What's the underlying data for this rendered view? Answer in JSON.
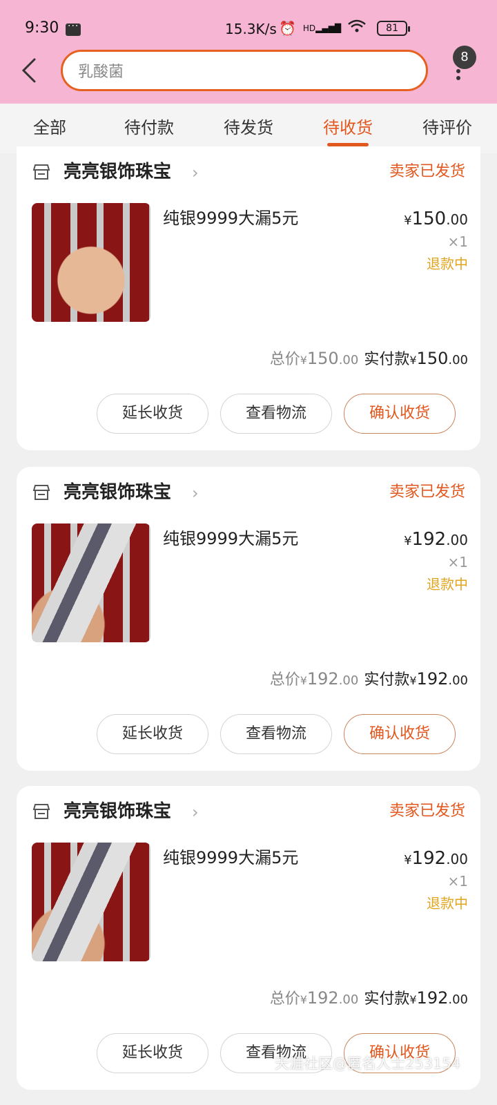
{
  "status_bar": {
    "time": "9:30",
    "speed": "15.3K/s",
    "network": "HD",
    "battery": "81"
  },
  "header": {
    "search_text": "乳酸菌",
    "badge_count": "8",
    "accent_color": "#e2571d"
  },
  "tabs": [
    {
      "label": "全部",
      "active": false
    },
    {
      "label": "待付款",
      "active": false
    },
    {
      "label": "待发货",
      "active": false
    },
    {
      "label": "待收货",
      "active": true
    },
    {
      "label": "待评价",
      "active": false
    }
  ],
  "orders": [
    {
      "shop": "亮亮银饰珠宝",
      "status": "卖家已发货",
      "title": "纯银9999大漏5元",
      "price_currency": "¥",
      "price_int": "150",
      "price_dec": ".00",
      "qty": "×1",
      "refund": "退款中",
      "total_label": "总价",
      "total_int": "150",
      "paid_label": "实付款",
      "paid_int": "150",
      "btn_extend": "延长收货",
      "btn_logistics": "查看物流",
      "btn_confirm": "确认收货"
    },
    {
      "shop": "亮亮银饰珠宝",
      "status": "卖家已发货",
      "title": "纯银9999大漏5元",
      "price_currency": "¥",
      "price_int": "192",
      "price_dec": ".00",
      "qty": "×1",
      "refund": "退款中",
      "total_label": "总价",
      "total_int": "192",
      "paid_label": "实付款",
      "paid_int": "192",
      "btn_extend": "延长收货",
      "btn_logistics": "查看物流",
      "btn_confirm": "确认收货"
    },
    {
      "shop": "亮亮银饰珠宝",
      "status": "卖家已发货",
      "title": "纯银9999大漏5元",
      "price_currency": "¥",
      "price_int": "192",
      "price_dec": ".00",
      "qty": "×1",
      "refund": "退款中",
      "total_label": "总价",
      "total_int": "192",
      "paid_label": "实付款",
      "paid_int": "192",
      "btn_extend": "延长收货",
      "btn_logistics": "查看物流",
      "btn_confirm": "确认收货"
    }
  ],
  "watermark": "天涯社区@匿名人士253154"
}
